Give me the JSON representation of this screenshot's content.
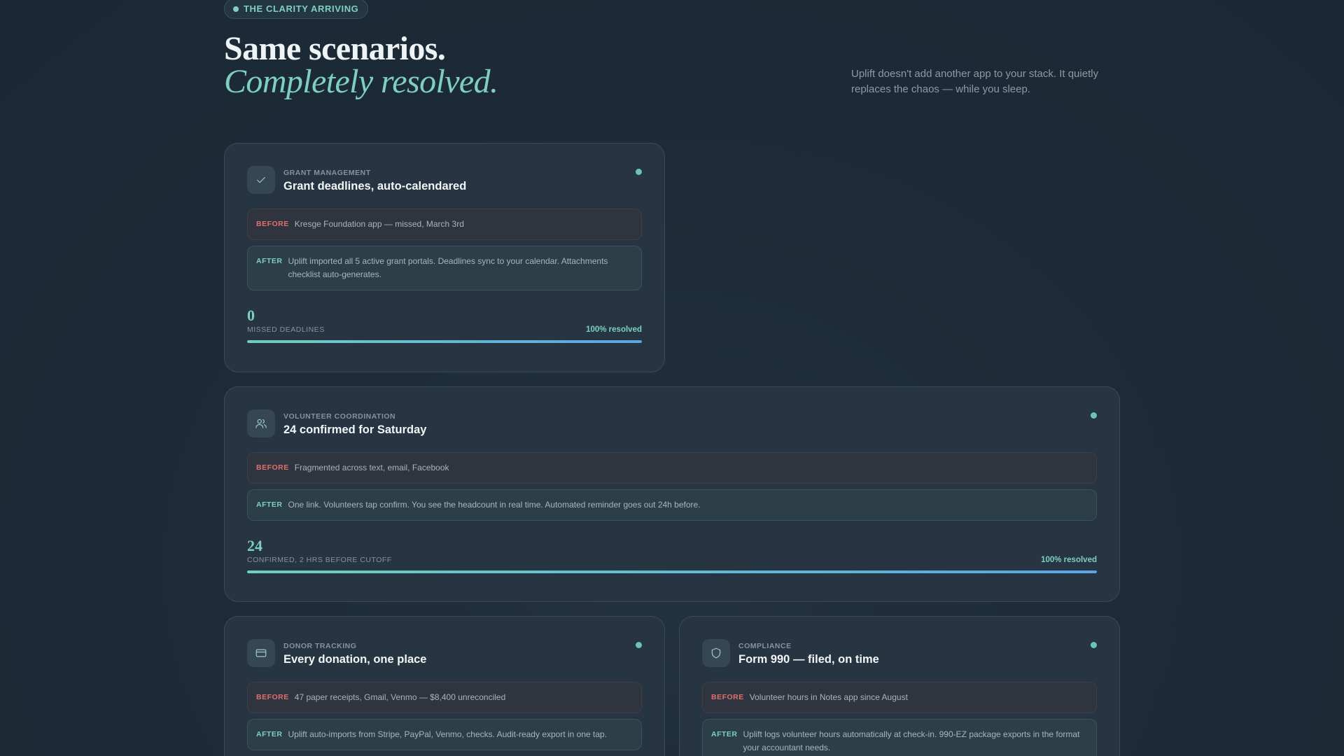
{
  "header": {
    "badge": "THE CLARITY ARRIVING",
    "title_line1": "Same scenarios.",
    "title_line2": "Completely resolved.",
    "subtitle": "Uplift doesn't add another app to your stack. It quietly replaces the chaos — while you sleep."
  },
  "labels": {
    "before": "BEFORE",
    "after": "AFTER"
  },
  "colors": {
    "accent": "#7ecfc0",
    "before_tag": "#e0706f",
    "progress_start": "#6fd0bd",
    "progress_end": "#5aa5e6"
  },
  "cards": [
    {
      "icon": "check-icon",
      "category": "GRANT MANAGEMENT",
      "title": "Grant deadlines, auto-calendared",
      "before": "Kresge Foundation app — missed, March 3rd",
      "after": "Uplift imported all 5 active grant portals. Deadlines sync to your calendar. Attachments checklist auto-generates.",
      "metric_value": "0",
      "metric_label": "MISSED DEADLINES",
      "resolved_label": "100% resolved",
      "progress": 1.0
    },
    {
      "icon": "users-icon",
      "category": "VOLUNTEER COORDINATION",
      "title": "24 confirmed for Saturday",
      "before": "Fragmented across text, email, Facebook",
      "after": "One link. Volunteers tap confirm. You see the headcount in real time. Automated reminder goes out 24h before.",
      "metric_value": "24",
      "metric_label": "CONFIRMED, 2 HRS BEFORE CUTOFF",
      "resolved_label": "100% resolved",
      "progress": 1.0
    },
    {
      "icon": "credit-card-icon",
      "category": "DONOR TRACKING",
      "title": "Every donation, one place",
      "before": "47 paper receipts, Gmail, Venmo — $8,400 unreconciled",
      "after": "Uplift auto-imports from Stripe, PayPal, Venmo, checks. Audit-ready export in one tap."
    },
    {
      "icon": "shield-icon",
      "category": "COMPLIANCE",
      "title": "Form 990 — filed, on time",
      "before": "Volunteer hours in Notes app since August",
      "after": "Uplift logs volunteer hours automatically at check-in. 990-EZ package exports in the format your accountant needs."
    }
  ]
}
